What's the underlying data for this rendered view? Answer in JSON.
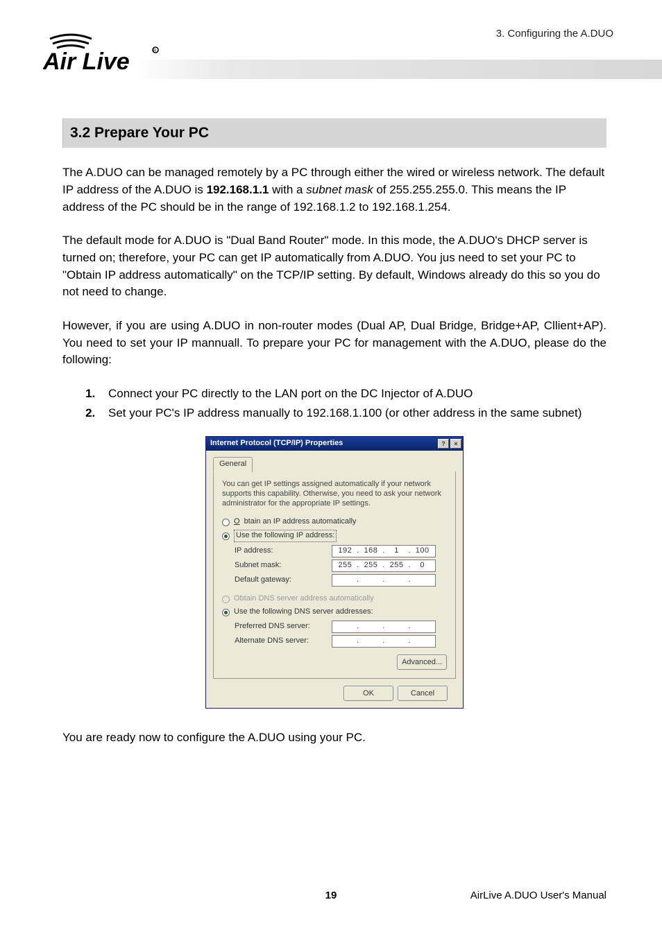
{
  "header": {
    "chapter": "3. Configuring the A.DUO",
    "logo_alt": "Air Live"
  },
  "section": {
    "heading": "3.2 Prepare Your PC"
  },
  "paragraphs": {
    "p1_a": "The A.DUO can be managed remotely by a PC through either the wired or wireless network. The default IP address of the A.DUO is ",
    "p1_ip": "192.168.1.1",
    "p1_b": " with a ",
    "p1_subnet_i": "subnet mask",
    "p1_c": " of 255.255.255.0. This means the IP address of the PC should be in the range of 192.168.1.2 to 192.168.1.254.",
    "p2": "The default mode for A.DUO is \"Dual Band Router\" mode.    In this mode, the A.DUO's DHCP server is turned on; therefore, your PC can get IP automatically from A.DUO.    You jus need to set your PC to \"Obtain IP address automatically\" on the TCP/IP setting.    By default, Windows already do this so you do not need to change.",
    "p3": "However, if you are using A.DUO in non-router modes (Dual AP, Dual Bridge, Bridge+AP, Cllient+AP).   You need to set your IP mannuall.   To prepare your PC for management with the A.DUO, please do the following:",
    "p4": "You are ready now to configure the A.DUO using your PC."
  },
  "list": {
    "item1": "Connect your PC directly to the LAN port on the DC Injector of A.DUO",
    "item2": "Set your PC's IP address manually to 192.168.1.100 (or other address in the same subnet)"
  },
  "dialog": {
    "title": "Internet Protocol (TCP/IP) Properties",
    "help_btn": "?",
    "close_btn": "×",
    "tab_general": "General",
    "description": "You can get IP settings assigned automatically if your network supports this capability. Otherwise, you need to ask your network administrator for the appropriate IP settings.",
    "opt_obtain_ip": "Obtain an IP address automatically",
    "opt_use_ip": "Use the following IP address:",
    "lbl_ip": "IP address:",
    "val_ip": [
      "192",
      "168",
      "1",
      "100"
    ],
    "lbl_mask": "Subnet mask:",
    "val_mask": [
      "255",
      "255",
      "255",
      "0"
    ],
    "lbl_gateway": "Default gateway:",
    "opt_obtain_dns": "Obtain DNS server address automatically",
    "opt_use_dns": "Use the following DNS server addresses:",
    "lbl_pref_dns": "Preferred DNS server:",
    "lbl_alt_dns": "Alternate DNS server:",
    "btn_advanced": "Advanced...",
    "btn_ok": "OK",
    "btn_cancel": "Cancel"
  },
  "footer": {
    "page": "19",
    "manual": "AirLive A.DUO User's Manual"
  }
}
